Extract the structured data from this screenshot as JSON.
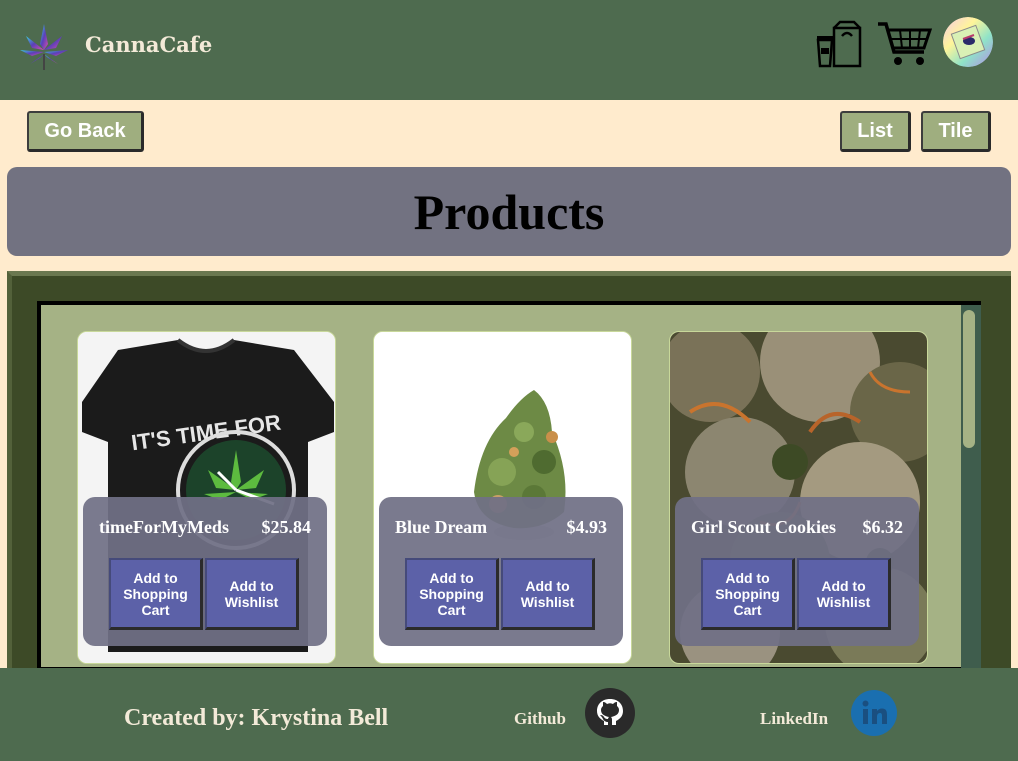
{
  "header": {
    "brand": "CannaCafe",
    "icons": [
      "cannabis-logo-icon",
      "coffee-bag-icon",
      "shopping-cart-icon",
      "user-avatar"
    ]
  },
  "toolbar": {
    "go_back": "Go Back",
    "list": "List",
    "tile": "Tile"
  },
  "page": {
    "title": "Products"
  },
  "products": [
    {
      "name": "timeForMyMeds",
      "price": "$25.84",
      "add_cart": "Add to Shopping Cart",
      "add_wishlist": "Add to Wishlist",
      "image": "black-tshirt"
    },
    {
      "name": "Blue Dream",
      "price": "$4.93",
      "add_cart": "Add to Shopping Cart",
      "add_wishlist": "Add to Wishlist",
      "image": "cannabis-bud"
    },
    {
      "name": "Girl Scout Cookies",
      "price": "$6.32",
      "add_cart": "Add to Shopping Cart",
      "add_wishlist": "Add to Wishlist",
      "image": "cannabis-macro"
    }
  ],
  "footer": {
    "credit": "Created by: Krystina Bell",
    "github": "Github",
    "linkedin": "LinkedIn"
  },
  "colors": {
    "header_bg": "#4e6b4f",
    "page_bg": "#ffebcd",
    "banner_bg": "#727281",
    "button_olive": "#9fae7f",
    "card_button": "#5c61a8"
  }
}
